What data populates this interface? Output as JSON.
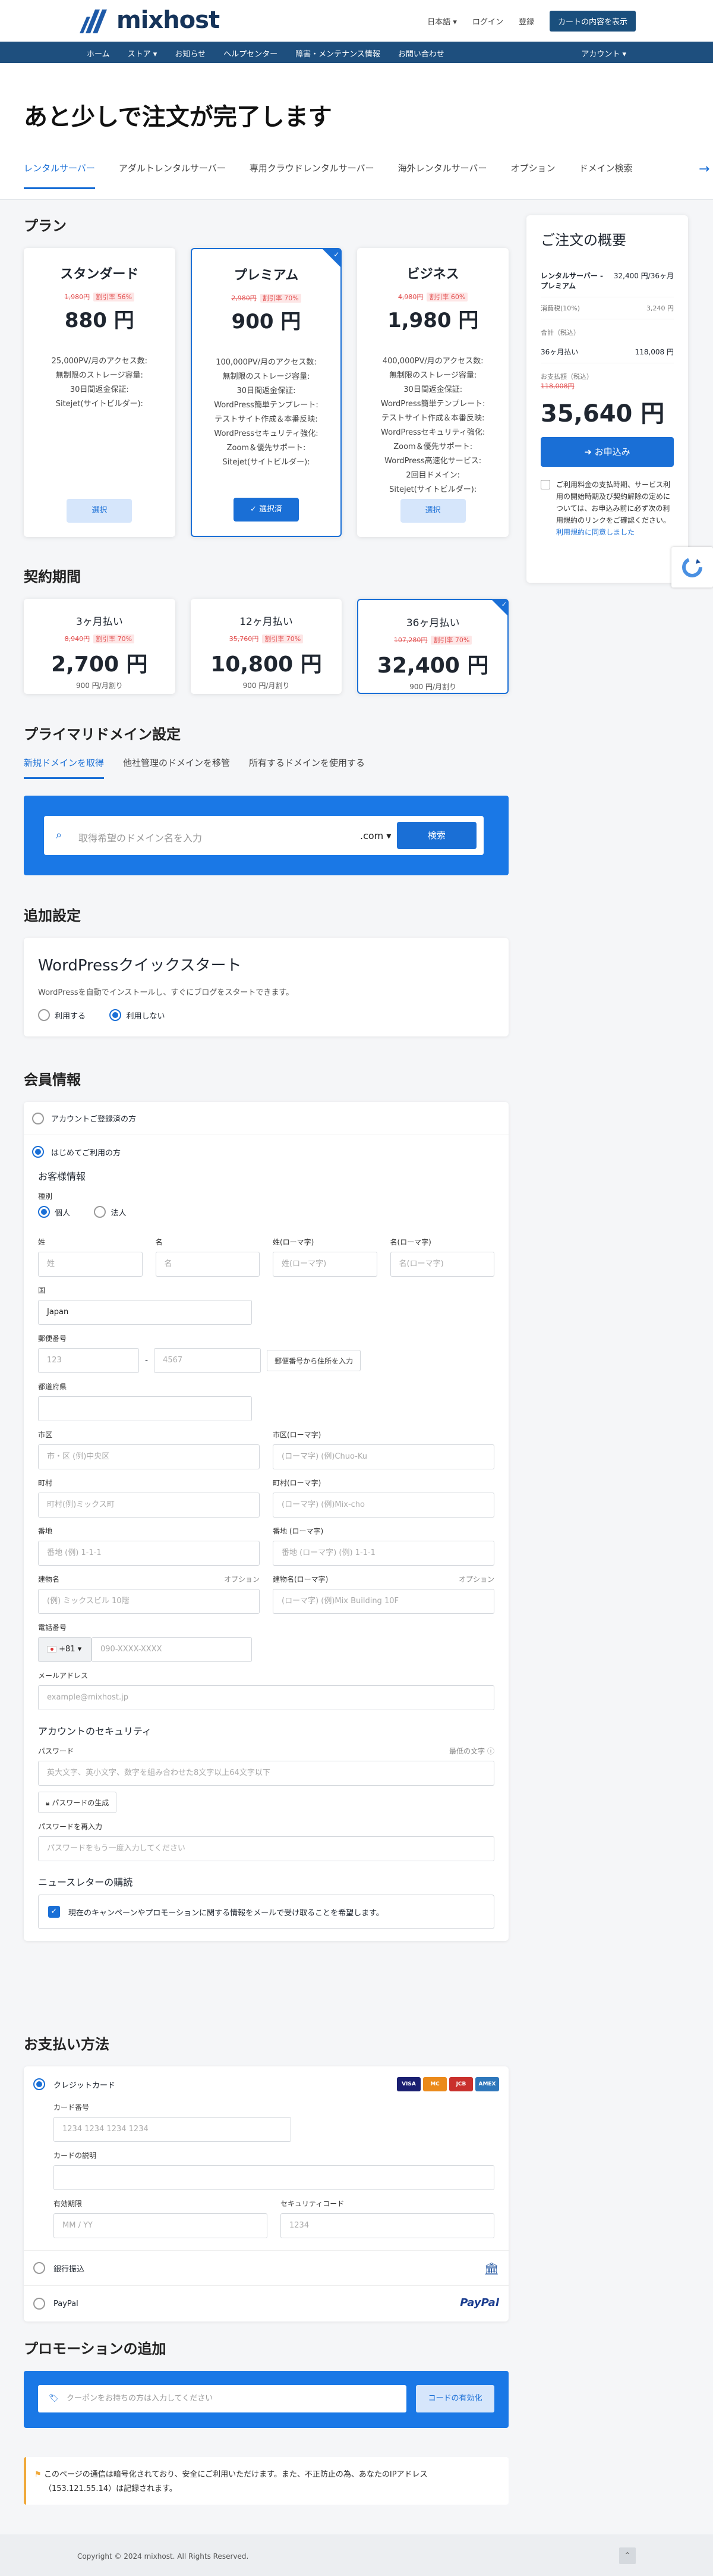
{
  "header": {
    "logo": "mixhost",
    "lang": "日本語",
    "login": "ログイン",
    "register": "登録",
    "cart_button": "カートの内容を表示"
  },
  "nav": {
    "items": [
      "ホーム",
      "ストア",
      "お知らせ",
      "ヘルプセンター",
      "障害・メンテナンス情報",
      "お問い合わせ"
    ],
    "account": "アカウント"
  },
  "hero": {
    "title": "あと少しで注文が完了します",
    "tabs": [
      "レンタルサーバー",
      "アダルトレンタルサーバー",
      "専用クラウドレンタルサーバー",
      "海外レンタルサーバー",
      "オプション",
      "ドメイン検索"
    ]
  },
  "plan": {
    "title": "プラン",
    "plans": [
      {
        "name": "スタンダード",
        "old": "1,980円",
        "discount": "割引率 56%",
        "price": "880 円",
        "features": [
          "25,000PV/月のアクセス数:",
          "無制限のストレージ容量:",
          "30日間返金保証:",
          "Sitejet(サイトビルダー):"
        ],
        "button": "選択"
      },
      {
        "name": "プレミアム",
        "old": "2,980円",
        "discount": "割引率 70%",
        "price": "900 円",
        "features": [
          "100,000PV/月のアクセス数:",
          "無制限のストレージ容量:",
          "30日間返金保証:",
          "WordPress簡単テンプレート:",
          "テストサイト作成＆本番反映:",
          "WordPressセキュリティ強化:",
          "Zoom＆優先サポート:",
          "Sitejet(サイトビルダー):"
        ],
        "button": "選択済"
      },
      {
        "name": "ビジネス",
        "old": "4,980円",
        "discount": "割引率 60%",
        "price": "1,980 円",
        "features": [
          "400,000PV/月のアクセス数:",
          "無制限のストレージ容量:",
          "30日間返金保証:",
          "WordPress簡単テンプレート:",
          "テストサイト作成＆本番反映:",
          "WordPressセキュリティ強化:",
          "Zoom＆優先サポート:",
          "WordPress高速化サービス:",
          "2回目ドメイン:",
          "Sitejet(サイトビルダー):"
        ],
        "button": "選択"
      }
    ]
  },
  "period": {
    "title": "契約期間",
    "items": [
      {
        "label": "3ヶ月払い",
        "old": "8,940円",
        "discount": "割引率 70%",
        "price": "2,700 円",
        "monthly": "900 円/月割り"
      },
      {
        "label": "12ヶ月払い",
        "old": "35,760円",
        "discount": "割引率 70%",
        "price": "10,800 円",
        "monthly": "900 円/月割り"
      },
      {
        "label": "36ヶ月払い",
        "old": "107,280円",
        "discount": "割引率 70%",
        "price": "32,400 円",
        "monthly": "900 円/月割り"
      }
    ]
  },
  "domain": {
    "title": "プライマリドメイン設定",
    "tabs": [
      "新規ドメインを取得",
      "他社管理のドメインを移管",
      "所有するドメインを使用する"
    ],
    "placeholder": "取得希望のドメイン名を入力",
    "tld": ".com",
    "search": "検索"
  },
  "addl": {
    "title": "追加設定",
    "wp_title": "WordPressクイックスタート",
    "wp_desc": "WordPressを自動でインストールし、すぐにブログをスタートできます。",
    "yes": "利用する",
    "no": "利用しない"
  },
  "member": {
    "title": "会員情報",
    "existing": "アカウントご登録済の方",
    "new": "はじめてご利用の方",
    "info": "お客様情報",
    "type_label": "種別",
    "individual": "個人",
    "corporate": "法人",
    "fields": {
      "last": "姓",
      "first": "名",
      "last_en": "姓(ローマ字)",
      "first_en": "名(ローマ字)",
      "country": "国",
      "country_val": "Japan",
      "zip": "郵便番号",
      "zip_ph1": "123",
      "zip_ph2": "4567",
      "zip_btn": "郵便番号から住所を入力",
      "pref": "都道府県",
      "city": "市区",
      "city_ph": "市・区 (例)中央区",
      "city_en": "市区(ローマ字)",
      "city_en_ph": "(ローマ字) (例)Chuo-Ku",
      "town": "町村",
      "town_ph": "町村(例)ミックス町",
      "town_en": "町村(ローマ字)",
      "town_en_ph": "(ローマ字) (例)Mix-cho",
      "block": "番地",
      "block_ph": "番地 (例) 1-1-1",
      "block_en": "番地 (ローマ字)",
      "block_en_ph": "番地 (ローマ字) (例) 1-1-1",
      "bldg": "建物名",
      "bldg_ph": "(例) ミックスビル 10階",
      "bldg_en": "建物名(ローマ字)",
      "bldg_en_ph": "(ローマ字) (例)Mix Building 10F",
      "optional": "オプション",
      "phone": "電話番号",
      "phone_cc": "+81",
      "phone_ph": "090-XXXX-XXXX",
      "email": "メールアドレス",
      "email_ph": "example@mixhost.jp"
    },
    "security": "アカウントのセキュリティ",
    "password": "パスワード",
    "strength": "最低の文字",
    "pw_ph": "英大文字、英小文字、数字を組み合わせた8文字以上64文字以下",
    "pw_gen": "パスワードの生成",
    "pw2": "パスワードを再入力",
    "pw2_ph": "パスワードをもう一度入力してください",
    "newsletter": "ニュースレターの購読",
    "newsletter_text": "現在のキャンペーンやプロモーションに関する情報をメールで受け取ることを希望します。"
  },
  "pay": {
    "title": "お支払い方法",
    "credit": "クレジットカード",
    "card_no": "カード番号",
    "card_ph": "1234 1234 1234 1234",
    "card_desc": "カードの説明",
    "expiry": "有効期限",
    "expiry_ph": "MM / YY",
    "cvc": "セキュリティコード",
    "cvc_ph": "1234",
    "bank": "銀行振込",
    "paypal": "PayPal",
    "brands": [
      "VISA",
      "MC",
      "JCB",
      "AMEX"
    ]
  },
  "promo": {
    "title": "プロモーションの追加",
    "placeholder": "クーポンをお持ちの方は入力してください",
    "button": "コードの有効化"
  },
  "security_note": "このページの通信は暗号化されており、安全にご利用いただけます。また、不正防止の為、あなたのIPアドレス（153.121.55.14）は記録されます。",
  "summary": {
    "title": "ご注文の概要",
    "item": "レンタルサーバー - プレミアム",
    "item_price": "32,400 円/36ヶ月",
    "tax_label": "消費税(10%)",
    "tax": "3,240 円",
    "subtotal_label": "合計（税込）",
    "subtotal_period": "36ヶ月払い",
    "subtotal": "118,008 円",
    "today_label": "お支払額（税込）",
    "today_old": "118,008円",
    "total": "35,640 円",
    "order": "お申込み",
    "terms": "ご利用料金の支払時期、サービス利用の開始時期及び契約解除の定めについては、お申込み前に必ず次の利用規約のリンクをご確認ください。",
    "terms_link": "利用規約に同意しました"
  },
  "footer": {
    "copyright": "Copyright © 2024 mixhost. All Rights Reserved."
  }
}
